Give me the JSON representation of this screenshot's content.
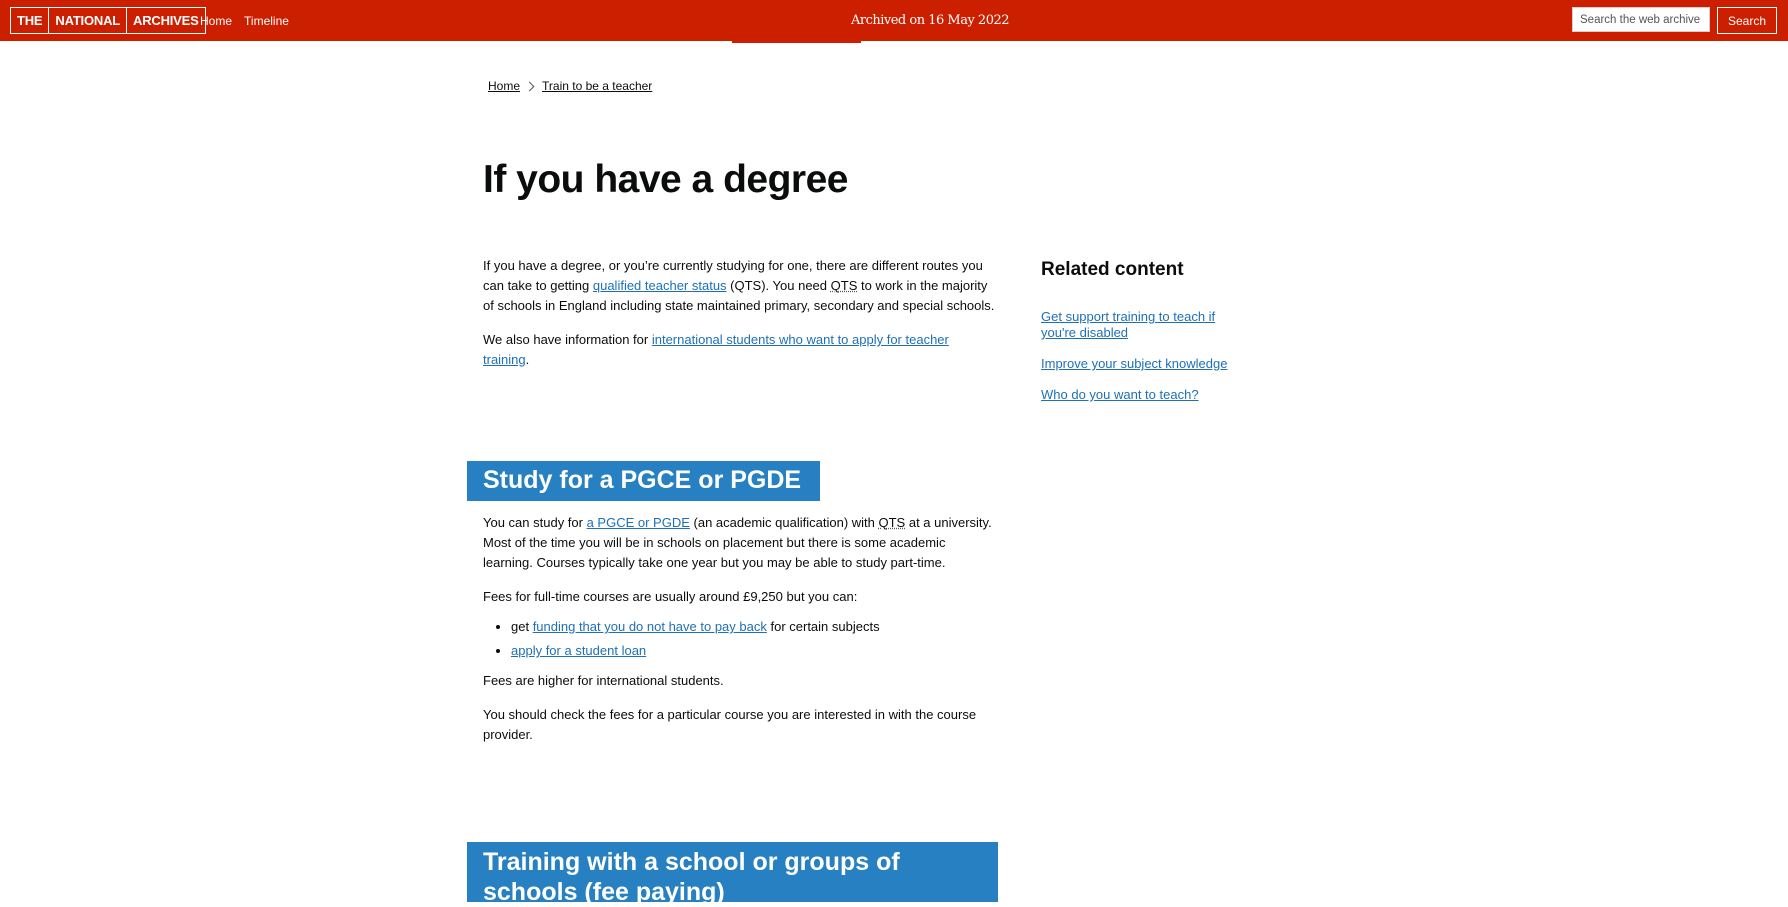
{
  "banner": {
    "logo": [
      "THE",
      "NATIONAL",
      "ARCHIVES"
    ],
    "nav": [
      "Home",
      "Timeline"
    ],
    "archived_label": "Archived on 16 May 2022",
    "search_placeholder": "Search the web archive",
    "search_button": "Search"
  },
  "breadcrumb": {
    "home": "Home",
    "current": "Train to be a teacher"
  },
  "page": {
    "title": "If you have a degree",
    "intro": {
      "p1_a": "If you have a degree, or you’re currently studying for one, there are different routes you can take to getting ",
      "p1_link": "qualified teacher status",
      "p1_b": " (QTS). You need ",
      "p1_abbr": "QTS",
      "p1_c": " to work in the majority of schools in England including state maintained primary, secondary and special schools.",
      "p2_a": "We also have information for ",
      "p2_link": "international students who want to apply for teacher training",
      "p2_b": "."
    },
    "pgce": {
      "heading": "Study for a PGCE or PGDE",
      "p1_a": "You can study for ",
      "p1_link": "a PGCE or PGDE",
      "p1_b": " (an academic qualification) with ",
      "p1_abbr": "QTS",
      "p1_c": " at a university. Most of the time you will be in schools on placement but there is some academic learning. Courses typically take one year but you may be able to study part-time.",
      "p2": "Fees for full-time courses are usually around £9,250 but you can:",
      "bullet1_a": "get ",
      "bullet1_link": "funding that you do not have to pay back",
      "bullet1_b": " for certain subjects",
      "bullet2_link": "apply for a student loan",
      "p3": "Fees are higher for international students.",
      "p4": "You should check the fees for a particular course you are interested in with the course provider."
    },
    "training": {
      "heading": "Training with a school or groups of schools (fee paying)"
    }
  },
  "related": {
    "heading": "Related content",
    "links": [
      "Get support training to teach if you're disabled",
      "Improve your subject knowledge",
      "Who do you want to teach?"
    ]
  },
  "colors": {
    "banner": "#cc1f00",
    "link": "#1d70b8",
    "heading_bg": "#2680c2",
    "text": "#0b0c0c"
  }
}
